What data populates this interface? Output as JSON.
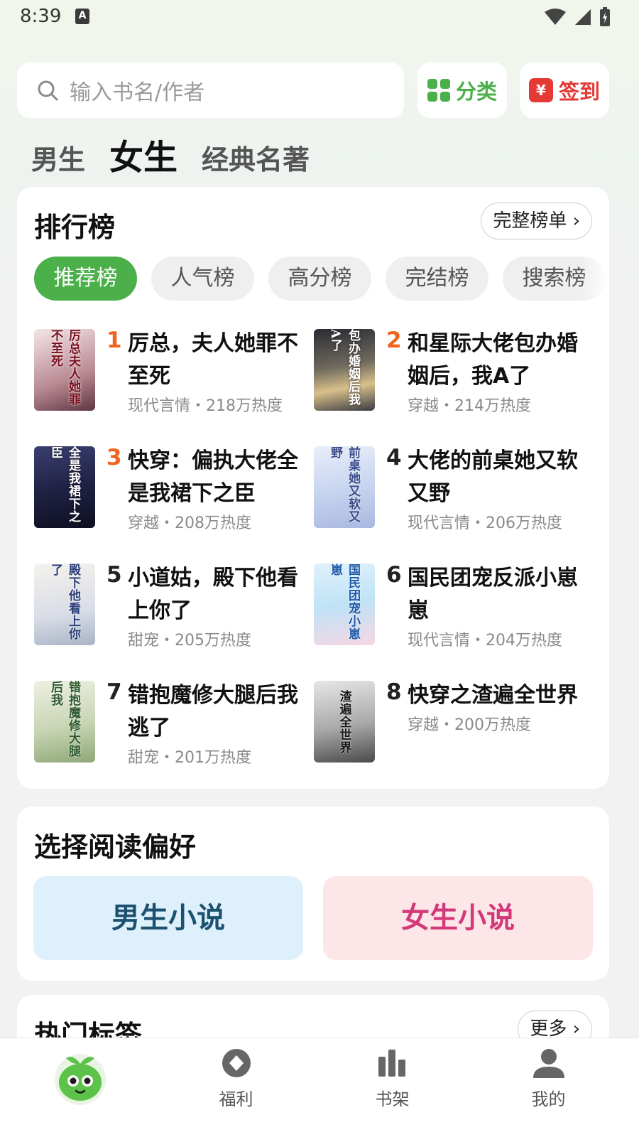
{
  "status": {
    "time": "8:39",
    "notif_letter": "A"
  },
  "search": {
    "placeholder": "输入书名/作者"
  },
  "top_buttons": {
    "category": "分类",
    "signin": "签到",
    "signin_icon_text": "¥"
  },
  "channels": [
    "男生",
    "女生",
    "经典名著"
  ],
  "ranking": {
    "title": "排行榜",
    "more": "完整榜单 ›",
    "tabs": [
      "推荐榜",
      "人气榜",
      "高分榜",
      "完结榜",
      "搜索榜"
    ],
    "books": [
      {
        "rank": "1",
        "title": "厉总，夫人她罪不至死",
        "meta": "现代言情・218万热度",
        "cover_text": "厉总夫人她罪不至死"
      },
      {
        "rank": "2",
        "title": "和星际大佬包办婚姻后，我A了",
        "meta": "穿越・214万热度",
        "cover_text": "包办婚姻后我A了"
      },
      {
        "rank": "3",
        "title": "快穿：偏执大佬全是我裙下之臣",
        "meta": "穿越・208万热度",
        "cover_text": "全是我裙下之臣"
      },
      {
        "rank": "4",
        "title": "大佬的前桌她又软又野",
        "meta": "现代言情・206万热度",
        "cover_text": "前桌她又软又野"
      },
      {
        "rank": "5",
        "title": "小道姑，殿下他看上你了",
        "meta": "甜宠・205万热度",
        "cover_text": "殿下他看上你了"
      },
      {
        "rank": "6",
        "title": "国民团宠反派小崽崽",
        "meta": "现代言情・204万热度",
        "cover_text": "国民团宠小崽崽"
      },
      {
        "rank": "7",
        "title": "错抱魔修大腿后我逃了",
        "meta": "甜宠・201万热度",
        "cover_text": "错抱魔修大腿后我"
      },
      {
        "rank": "8",
        "title": "快穿之渣遍全世界",
        "meta": "穿越・200万热度",
        "cover_text": "渣遍全世界"
      }
    ]
  },
  "preference": {
    "title": "选择阅读偏好",
    "male": "男生小说",
    "female": "女生小说"
  },
  "tags": {
    "title": "热门标签",
    "more": "更多 ›"
  },
  "nav": {
    "welfare": "福利",
    "shelf": "书架",
    "mine": "我的"
  },
  "colors": {
    "accent": "#4bb04a",
    "rank_top": "#f2631c",
    "signin_red": "#e53935"
  }
}
